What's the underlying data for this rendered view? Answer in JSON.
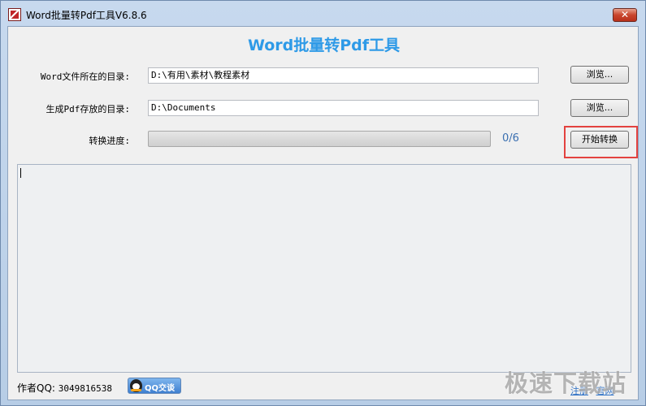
{
  "window": {
    "title": "Word批量转Pdf工具V6.8.6",
    "close_label": "✕"
  },
  "header": {
    "title": "Word批量转Pdf工具"
  },
  "form": {
    "source_label": "Word文件所在的目录:",
    "source_value": "D:\\有用\\素材\\教程素材",
    "source_browse": "浏览...",
    "output_label": "生成Pdf存放的目录:",
    "output_value": "D:\\Documents",
    "output_browse": "浏览...",
    "progress_label": "转换进度:",
    "progress_count": "0/6",
    "progress_fraction": 0,
    "start_button": "开始转换"
  },
  "footer": {
    "author_label": "作者QQ:",
    "author_qq": "3049816538",
    "qq_button": "QQ交谈",
    "links": [
      "注册",
      "官网"
    ]
  },
  "watermark": "极速下载站",
  "colors": {
    "title_blue": "#2e9ae7",
    "highlight_red": "#e3423f"
  }
}
